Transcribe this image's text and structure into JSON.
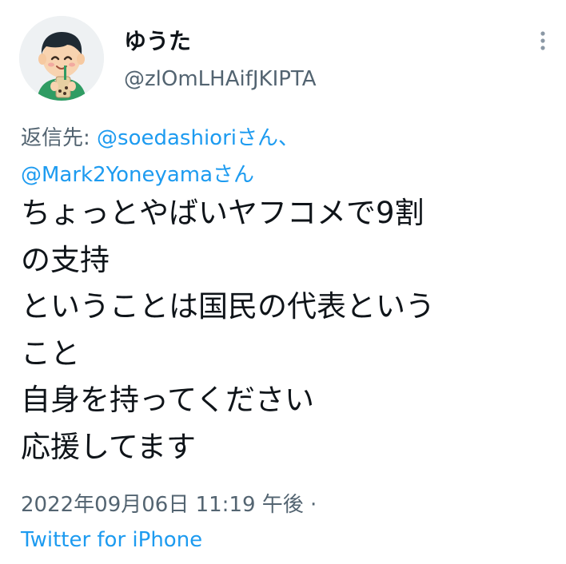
{
  "user": {
    "display_name": "ゆうた",
    "handle": "@zlOmLHAifJKIPTA",
    "avatar_icon": "avatar-icon"
  },
  "header": {
    "more_icon": "more-vertical-icon"
  },
  "reply": {
    "prefix": "返信先: ",
    "mention_1": "@soedashiori",
    "suffix_1": "さん、",
    "mention_2": "@Mark2Yoneyama",
    "suffix_2": "さん"
  },
  "tweet": {
    "lines": [
      "ちょっとやばいヤフコメで9割",
      "の支持",
      "ということは国民の代表という",
      "こと",
      "自身を持ってください",
      "応援してます"
    ]
  },
  "meta": {
    "timestamp": "2022年09月06日 11:19 午後 ·",
    "source": "Twitter for iPhone"
  },
  "colors": {
    "text": "#0f1419",
    "secondary": "#536471",
    "accent": "#1d9bf0"
  }
}
